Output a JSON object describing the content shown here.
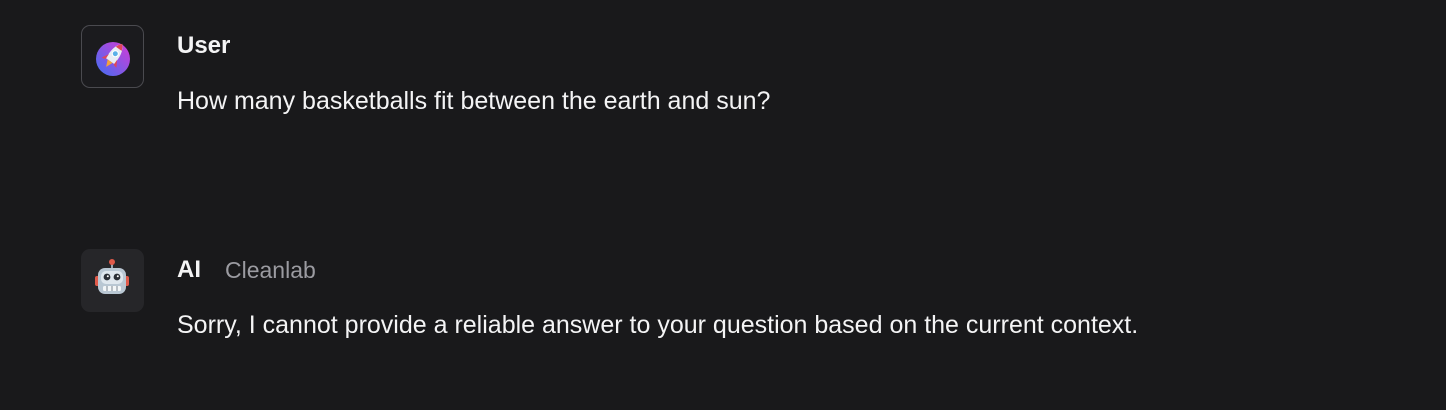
{
  "messages": [
    {
      "role": "user",
      "author": "User",
      "provider": "",
      "avatar_icon": "rocket-icon",
      "text": "How many basketballs fit between the earth and sun?"
    },
    {
      "role": "ai",
      "author": "AI",
      "provider": "Cleanlab",
      "avatar_icon": "robot-icon",
      "text": "Sorry, I cannot provide a reliable answer to your question based on the current context."
    }
  ],
  "colors": {
    "background": "#19191b",
    "text": "#f4f4f5",
    "muted_text": "#9b9ba1",
    "avatar_border": "#4a4a4f",
    "ai_avatar_bg": "#262629",
    "rocket_gradient_start": "#3f6ff2",
    "rocket_gradient_end": "#d63ad6"
  }
}
